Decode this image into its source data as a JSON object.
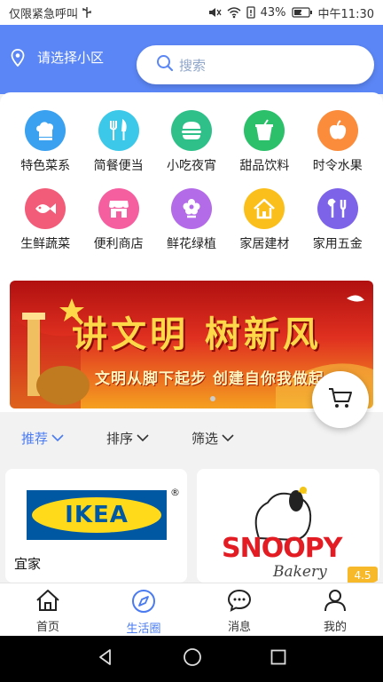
{
  "status_bar": {
    "left_text": "仅限紧急呼叫",
    "battery": "43%",
    "time": "中午11:30"
  },
  "header": {
    "location_label": "请选择小区",
    "search_placeholder": "搜索",
    "bg_color": "#5b86f5"
  },
  "categories": [
    {
      "label": "特色菜系",
      "icon": "chef-hat-icon",
      "color": "#3aa0f0"
    },
    {
      "label": "简餐便当",
      "icon": "fork-knife-icon",
      "color": "#3cc8e8"
    },
    {
      "label": "小吃夜宵",
      "icon": "burger-icon",
      "color": "#2fc08a"
    },
    {
      "label": "甜品饮料",
      "icon": "drink-cup-icon",
      "color": "#2cc06a"
    },
    {
      "label": "时令水果",
      "icon": "apple-icon",
      "color": "#fa8c3c"
    },
    {
      "label": "生鲜蔬菜",
      "icon": "fish-icon",
      "color": "#f25c78"
    },
    {
      "label": "便利商店",
      "icon": "store-icon",
      "color": "#f55fa0"
    },
    {
      "label": "鲜花绿植",
      "icon": "flower-icon",
      "color": "#b36be8"
    },
    {
      "label": "家居建材",
      "icon": "house-icon",
      "color": "#fbbf1c"
    },
    {
      "label": "家用五金",
      "icon": "tools-icon",
      "color": "#7c63e8"
    }
  ],
  "banner": {
    "title": "讲文明 树新风",
    "subtitle": "文明从脚下起步 创建自你我做起"
  },
  "filters": {
    "recommend": "推荐",
    "sort": "排序",
    "filter": "筛选"
  },
  "shops": [
    {
      "name": "宜家",
      "logo_text": "IKEA",
      "registered_mark": "®"
    },
    {
      "logo_text": "SNOOPY",
      "logo_sub": "Bakery",
      "rating": "4.5"
    }
  ],
  "tabs": [
    {
      "label": "首页",
      "icon": "home-icon"
    },
    {
      "label": "生活圈",
      "icon": "compass-icon"
    },
    {
      "label": "消息",
      "icon": "chat-icon"
    },
    {
      "label": "我的",
      "icon": "user-icon"
    }
  ],
  "accent_color": "#4a7bf0"
}
